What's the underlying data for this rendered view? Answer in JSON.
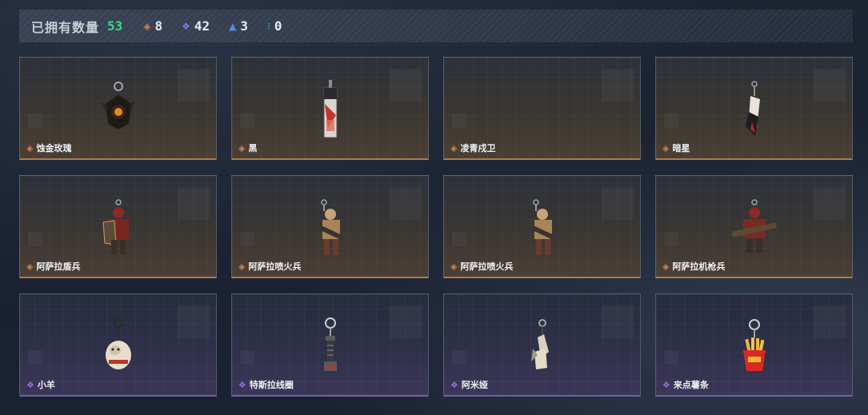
{
  "stats": {
    "owned_label": "已拥有数量",
    "owned_count": "53",
    "items": [
      {
        "icon": "orange-diamond-icon",
        "value": "8",
        "color": "#d0874c"
      },
      {
        "icon": "purple-diamond-icon",
        "value": "42",
        "color": "#8d73d8"
      },
      {
        "icon": "blue-chevron-icon",
        "value": "3",
        "color": "#4e8fd8"
      },
      {
        "icon": "teal-dots-icon",
        "value": "0",
        "color": "#3fc4a8"
      }
    ]
  },
  "cards": [
    {
      "name": "蚀金玫瑰",
      "rarity": "orange"
    },
    {
      "name": "黑",
      "rarity": "orange"
    },
    {
      "name": "凌青戍卫",
      "rarity": "orange"
    },
    {
      "name": "暗星",
      "rarity": "orange"
    },
    {
      "name": "阿萨拉盾兵",
      "rarity": "orange"
    },
    {
      "name": "阿萨拉喷火兵",
      "rarity": "orange"
    },
    {
      "name": "阿萨拉喷火兵",
      "rarity": "orange"
    },
    {
      "name": "阿萨拉机枪兵",
      "rarity": "orange"
    },
    {
      "name": "小羊",
      "rarity": "purple"
    },
    {
      "name": "特斯拉线圈",
      "rarity": "purple"
    },
    {
      "name": "阿米娅",
      "rarity": "purple"
    },
    {
      "name": "来点薯条",
      "rarity": "purple"
    }
  ]
}
